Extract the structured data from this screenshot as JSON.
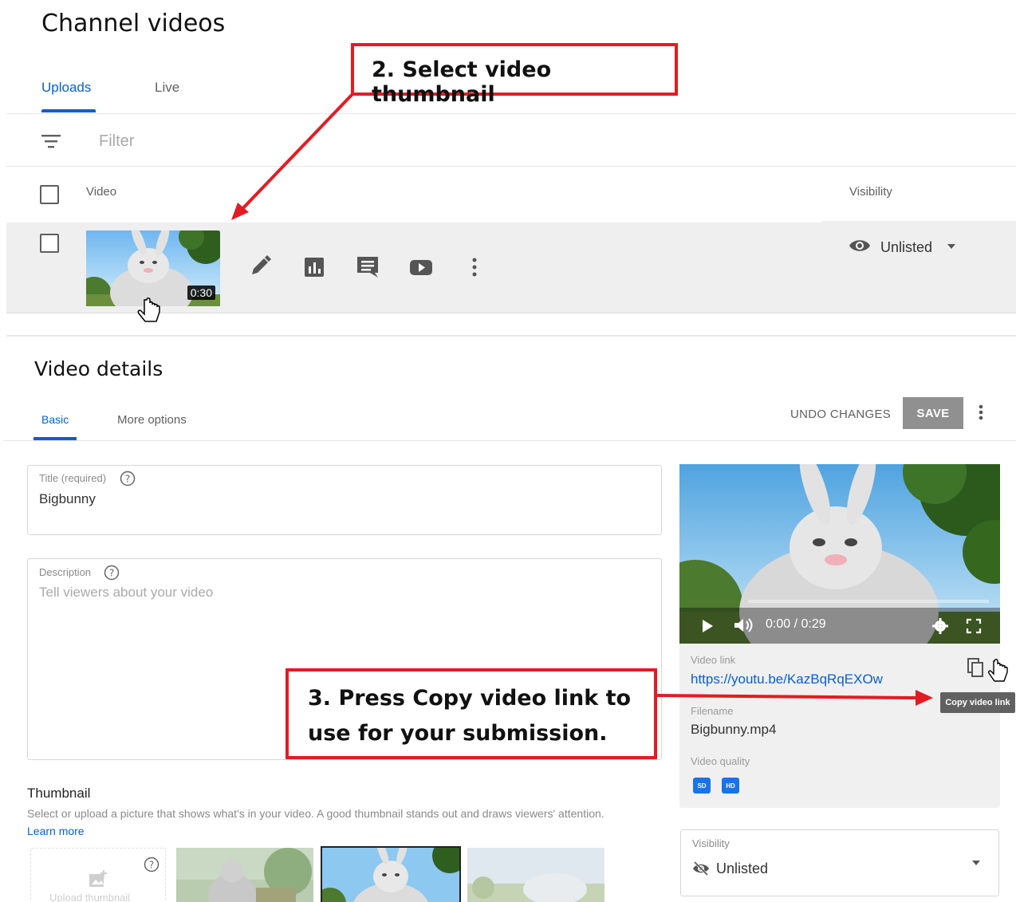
{
  "header": {
    "title": "Channel videos",
    "tabs": [
      {
        "label": "Uploads",
        "active": true
      },
      {
        "label": "Live",
        "active": false
      }
    ],
    "filter_placeholder": "Filter"
  },
  "table": {
    "columns": {
      "video": "Video",
      "visibility": "Visibility"
    },
    "rows": [
      {
        "duration": "0:30",
        "actions": [
          "edit-icon",
          "analytics-icon",
          "comments-icon",
          "youtube-icon",
          "more-vert-icon"
        ],
        "visibility": "Unlisted"
      }
    ]
  },
  "details": {
    "title": "Video details",
    "tabs": [
      {
        "label": "Basic",
        "active": true
      },
      {
        "label": "More options",
        "active": false
      }
    ],
    "undo_label": "UNDO CHANGES",
    "save_label": "SAVE",
    "title_field": {
      "label": "Title (required)",
      "value": "Bigbunny"
    },
    "description_field": {
      "label": "Description",
      "placeholder": "Tell viewers about your video"
    },
    "thumbnail": {
      "heading": "Thumbnail",
      "description": "Select or upload a picture that shows what's in your video. A good thumbnail stands out and draws viewers' attention.",
      "learn_more": "Learn more",
      "upload_label": "Upload thumbnail"
    }
  },
  "player": {
    "time": "0:00 / 0:29",
    "video_link_label": "Video link",
    "video_link": "https://youtu.be/KazBqRqEXOw",
    "filename_label": "Filename",
    "filename": "Bigbunny.mp4",
    "quality_label": "Video quality",
    "quality_badges": [
      "SD",
      "HD"
    ],
    "copy_tooltip": "Copy video link"
  },
  "visibility_card": {
    "label": "Visibility",
    "value": "Unlisted"
  },
  "annotations": {
    "step2": "2. Select video thumbnail",
    "step3_line1": "3. Press Copy video link to",
    "step3_line2": "use for your submission."
  },
  "colors": {
    "accent": "#065fd4",
    "annotation": "#e41b23",
    "save_disabled": "#909090"
  }
}
